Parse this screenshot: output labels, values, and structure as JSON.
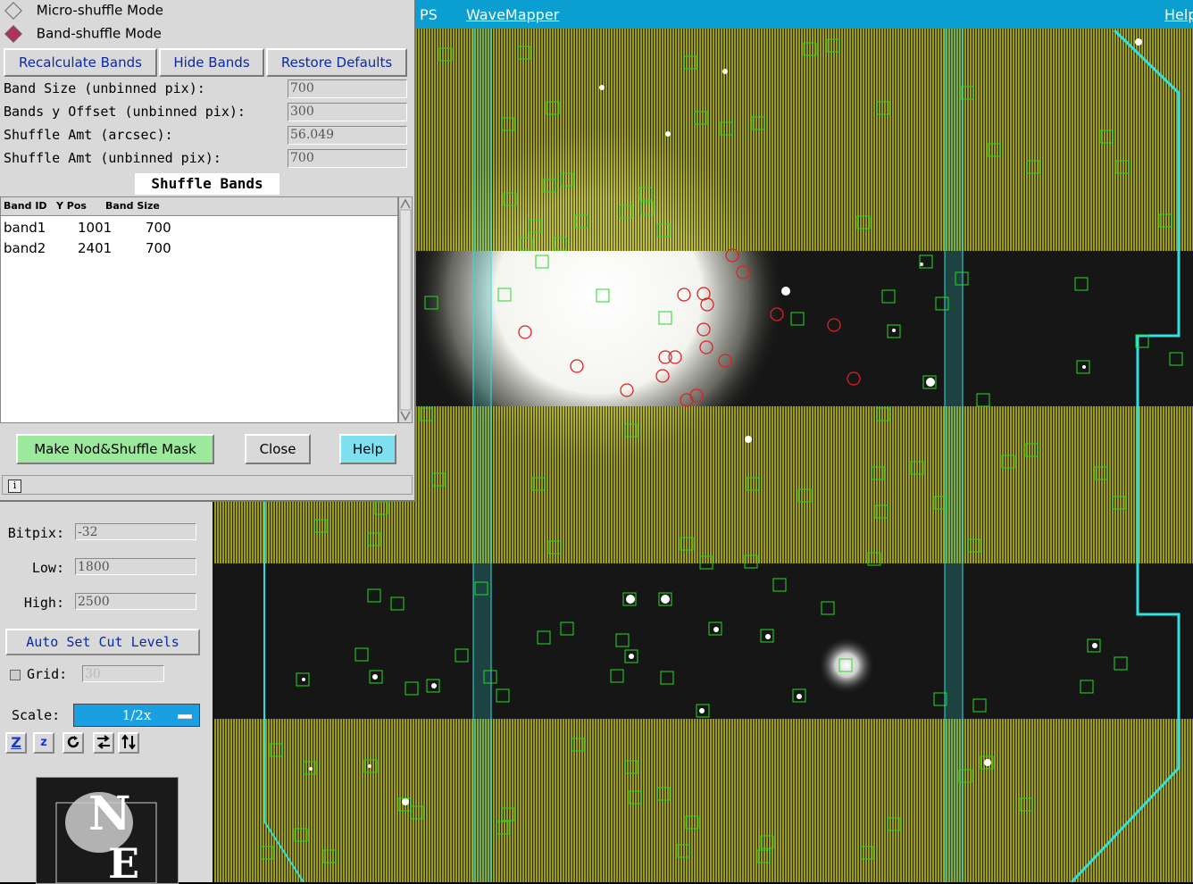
{
  "app": {
    "menubar": {
      "left_item": "PS",
      "wavemapper": "WaveMapper",
      "help": "Help"
    }
  },
  "dialog": {
    "modes": [
      {
        "label": "Micro-shuffle Mode",
        "selected": false
      },
      {
        "label": "Band-shuffle Mode",
        "selected": true
      }
    ],
    "buttons": {
      "recalculate": "Recalculate Bands",
      "hide": "Hide Bands",
      "restore": "Restore Defaults"
    },
    "params": [
      {
        "label": "Band Size (unbinned pix):",
        "value": "700"
      },
      {
        "label": "Bands y Offset (unbinned pix):",
        "value": "300"
      },
      {
        "label": "Shuffle Amt (arcsec):",
        "value": "56.049"
      },
      {
        "label": "Shuffle Amt (unbinned pix):",
        "value": "700"
      }
    ],
    "table_title": "Shuffle Bands",
    "table": {
      "columns": [
        "Band ID",
        "Y Pos",
        "Band Size"
      ],
      "rows": [
        [
          "band1",
          "1001",
          "700"
        ],
        [
          "band2",
          "2401",
          "700"
        ]
      ]
    },
    "footer": {
      "make_mask": "Make Nod&Shuffle Mask",
      "close": "Close",
      "help": "Help"
    },
    "status_icon": "info-icon"
  },
  "controls": {
    "bitpix_label": "Bitpix:",
    "bitpix_value": "-32",
    "low_label": "Low:",
    "low_value": "1800",
    "high_label": "High:",
    "high_value": "2500",
    "auto_cut": "Auto Set Cut Levels",
    "grid_label": "Grid:",
    "grid_value": "30",
    "scale_label": "Scale:",
    "scale_value": "1/2x",
    "toolbar_icons": [
      "zoom-in-icon",
      "zoom-out-icon",
      "rotate-icon",
      "flip-x-icon",
      "flip-y-icon"
    ],
    "compass": {
      "north": "N",
      "east": "E"
    }
  },
  "colors": {
    "menubar": "#0a9fd0",
    "band_fill": "#b4b41e",
    "slit_box": "#22dd22",
    "target_circle": "#dd2222",
    "cyan_outline": "#30e0e0",
    "help_button": "#7fe0f0",
    "make_mask_button": "#9ce89c"
  }
}
